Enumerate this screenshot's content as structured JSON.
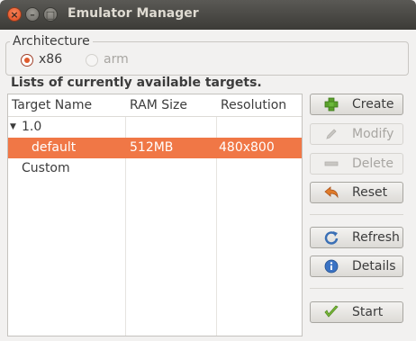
{
  "window": {
    "title": "Emulator Manager"
  },
  "architecture": {
    "legend": "Architecture",
    "options": [
      {
        "label": "x86",
        "selected": true,
        "enabled": true
      },
      {
        "label": "arm",
        "selected": false,
        "enabled": false
      }
    ]
  },
  "targets": {
    "heading": "Lists of currently available targets.",
    "columns": [
      "Target Name",
      "RAM Size",
      "Resolution"
    ],
    "rows": [
      {
        "name": "1.0",
        "ram": "",
        "resolution": "",
        "expanded": true
      },
      {
        "name": "default",
        "ram": "512MB",
        "resolution": "480x800",
        "selected": true
      },
      {
        "name": "Custom",
        "ram": "",
        "resolution": ""
      }
    ]
  },
  "buttons": {
    "create": "Create",
    "modify": "Modify",
    "delete": "Delete",
    "reset": "Reset",
    "refresh": "Refresh",
    "details": "Details",
    "start": "Start"
  },
  "colors": {
    "selection": "#f07746",
    "titlebar": "#3c3b37",
    "accent": "#e05a2b"
  }
}
